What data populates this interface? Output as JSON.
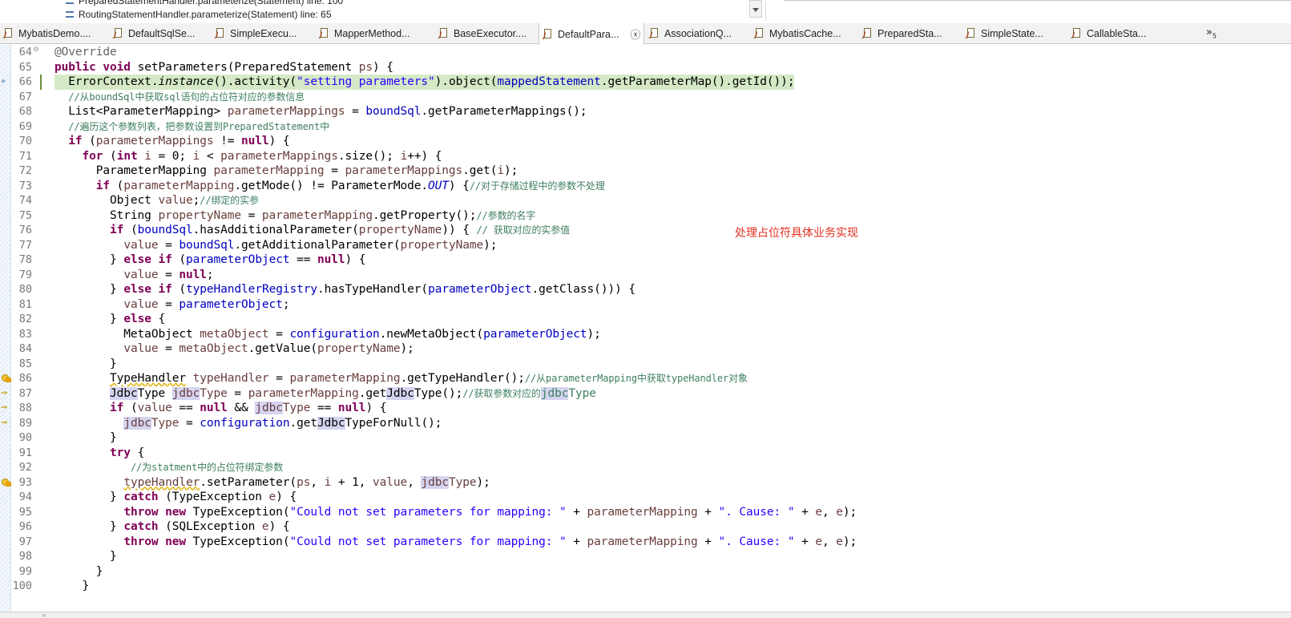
{
  "stack_panel": {
    "lines": [
      "PreparedStatementHandler.parameterize(Statement) line: 100",
      "RoutingStatementHandler.parameterize(Statement) line: 65"
    ]
  },
  "tabs": [
    {
      "label": "MybatisDemo....",
      "active": false
    },
    {
      "label": "DefaultSqlSe...",
      "active": false
    },
    {
      "label": "SimpleExecu...",
      "active": false
    },
    {
      "label": "MapperMethod...",
      "active": false
    },
    {
      "label": "BaseExecutor....",
      "active": false
    },
    {
      "label": "DefaultPara...",
      "active": true
    },
    {
      "label": "AssociationQ...",
      "active": false
    },
    {
      "label": "MybatisCache...",
      "active": false
    },
    {
      "label": "PreparedSta...",
      "active": false
    },
    {
      "label": "SimpleState...",
      "active": false
    },
    {
      "label": "CallableSta...",
      "active": false
    }
  ],
  "overflow": {
    "symbol": "»",
    "count": "5"
  },
  "close_symbol": "ⓧ",
  "editor": {
    "current_line": 66,
    "fold_symbol": "⊖",
    "lines": [
      {
        "n": "64",
        "tokens": [
          [
            "ann",
            "@Override"
          ]
        ]
      },
      {
        "n": "65",
        "tokens": [
          [
            "kw",
            "public"
          ],
          [
            "",
            " "
          ],
          [
            "kw",
            "void"
          ],
          [
            "",
            " setParameters(PreparedStatement "
          ],
          [
            "loc",
            "ps"
          ],
          [
            "",
            ") {"
          ]
        ]
      },
      {
        "n": "66",
        "tokens": [
          [
            "",
            "  ErrorContext."
          ],
          [
            "ital",
            "instance"
          ],
          [
            "",
            "().activity("
          ],
          [
            "str",
            "\"setting parameters\""
          ],
          [
            "",
            ")."
          ],
          [
            "",
            "object("
          ],
          [
            "fld",
            "mappedStatement"
          ],
          [
            "",
            ".getParameterMap().getId());"
          ]
        ]
      },
      {
        "n": "67",
        "tokens": [
          [
            "",
            "  "
          ],
          [
            "cm",
            "//从boundSql中获取sql语句的占位符对应的参数信息"
          ]
        ]
      },
      {
        "n": "68",
        "tokens": [
          [
            "",
            "  List<ParameterMapping> "
          ],
          [
            "loc",
            "parameterMappings"
          ],
          [
            "",
            " = "
          ],
          [
            "fld",
            "boundSql"
          ],
          [
            "",
            ".getParameterMappings();"
          ]
        ]
      },
      {
        "n": "69",
        "tokens": [
          [
            "",
            "  "
          ],
          [
            "cm",
            "//遍历这个参数列表，把参数设置到PreparedStatement中"
          ]
        ]
      },
      {
        "n": "70",
        "tokens": [
          [
            "",
            "  "
          ],
          [
            "kw",
            "if"
          ],
          [
            "",
            " ("
          ],
          [
            "loc",
            "parameterMappings"
          ],
          [
            "",
            " != "
          ],
          [
            "kw",
            "null"
          ],
          [
            "",
            ") {"
          ]
        ]
      },
      {
        "n": "71",
        "tokens": [
          [
            "",
            "    "
          ],
          [
            "kw",
            "for"
          ],
          [
            "",
            " ("
          ],
          [
            "kw",
            "int"
          ],
          [
            "",
            " "
          ],
          [
            "loc",
            "i"
          ],
          [
            "",
            " = 0; "
          ],
          [
            "loc",
            "i"
          ],
          [
            "",
            " < "
          ],
          [
            "loc",
            "parameterMappings"
          ],
          [
            "",
            ".size(); "
          ],
          [
            "loc",
            "i"
          ],
          [
            "",
            "++) {"
          ]
        ]
      },
      {
        "n": "72",
        "tokens": [
          [
            "",
            "      ParameterMapping "
          ],
          [
            "loc",
            "parameterMapping"
          ],
          [
            "",
            " = "
          ],
          [
            "loc",
            "parameterMappings"
          ],
          [
            "",
            ".get("
          ],
          [
            "loc",
            "i"
          ],
          [
            "",
            ");"
          ]
        ]
      },
      {
        "n": "73",
        "tokens": [
          [
            "",
            "      "
          ],
          [
            "kw",
            "if"
          ],
          [
            "",
            " ("
          ],
          [
            "loc",
            "parameterMapping"
          ],
          [
            "",
            ".getMode() != ParameterMode."
          ],
          [
            "fld-it",
            "OUT"
          ],
          [
            "",
            ") {"
          ],
          [
            "cm",
            "//对于存储过程中的参数不处理"
          ]
        ]
      },
      {
        "n": "74",
        "tokens": [
          [
            "",
            "        Object "
          ],
          [
            "loc",
            "value"
          ],
          [
            "",
            ";"
          ],
          [
            "cm",
            "//绑定的实参"
          ]
        ]
      },
      {
        "n": "75",
        "tokens": [
          [
            "",
            "        String "
          ],
          [
            "loc",
            "propertyName"
          ],
          [
            "",
            " = "
          ],
          [
            "loc",
            "parameterMapping"
          ],
          [
            "",
            ".getProperty();"
          ],
          [
            "cm",
            "//参数的名字"
          ]
        ]
      },
      {
        "n": "76",
        "tokens": [
          [
            "",
            "        "
          ],
          [
            "kw",
            "if"
          ],
          [
            "",
            " ("
          ],
          [
            "fld",
            "boundSql"
          ],
          [
            "",
            ".hasAdditionalParameter("
          ],
          [
            "loc",
            "propertyName"
          ],
          [
            "",
            ")) { "
          ],
          [
            "cm",
            "// 获取对应的实参值"
          ]
        ]
      },
      {
        "n": "77",
        "tokens": [
          [
            "",
            "          "
          ],
          [
            "loc",
            "value"
          ],
          [
            "",
            " = "
          ],
          [
            "fld",
            "boundSql"
          ],
          [
            "",
            ".getAdditionalParameter("
          ],
          [
            "loc",
            "propertyName"
          ],
          [
            "",
            ");"
          ]
        ]
      },
      {
        "n": "78",
        "tokens": [
          [
            "",
            "        } "
          ],
          [
            "kw",
            "else"
          ],
          [
            "",
            " "
          ],
          [
            "kw",
            "if"
          ],
          [
            "",
            " ("
          ],
          [
            "fld",
            "parameterObject"
          ],
          [
            "",
            " == "
          ],
          [
            "kw",
            "null"
          ],
          [
            "",
            ") {"
          ]
        ]
      },
      {
        "n": "79",
        "tokens": [
          [
            "",
            "          "
          ],
          [
            "loc",
            "value"
          ],
          [
            "",
            " = "
          ],
          [
            "kw",
            "null"
          ],
          [
            "",
            ";"
          ]
        ]
      },
      {
        "n": "80",
        "tokens": [
          [
            "",
            "        } "
          ],
          [
            "kw",
            "else"
          ],
          [
            "",
            " "
          ],
          [
            "kw",
            "if"
          ],
          [
            "",
            " ("
          ],
          [
            "fld",
            "typeHandlerRegistry"
          ],
          [
            "",
            ".hasTypeHandler("
          ],
          [
            "fld",
            "parameterObject"
          ],
          [
            "",
            ".getClass())) {"
          ]
        ]
      },
      {
        "n": "81",
        "tokens": [
          [
            "",
            "          "
          ],
          [
            "loc",
            "value"
          ],
          [
            "",
            " = "
          ],
          [
            "fld",
            "parameterObject"
          ],
          [
            "",
            ";"
          ]
        ]
      },
      {
        "n": "82",
        "tokens": [
          [
            "",
            "        } "
          ],
          [
            "kw",
            "else"
          ],
          [
            "",
            " {"
          ]
        ]
      },
      {
        "n": "83",
        "tokens": [
          [
            "",
            "          MetaObject "
          ],
          [
            "loc",
            "metaObject"
          ],
          [
            "",
            " = "
          ],
          [
            "fld",
            "configuration"
          ],
          [
            "",
            ".newMetaObject("
          ],
          [
            "fld",
            "parameterObject"
          ],
          [
            "",
            ");"
          ]
        ]
      },
      {
        "n": "84",
        "tokens": [
          [
            "",
            "          "
          ],
          [
            "loc",
            "value"
          ],
          [
            "",
            " = "
          ],
          [
            "loc",
            "metaObject"
          ],
          [
            "",
            ".getValue("
          ],
          [
            "loc",
            "propertyName"
          ],
          [
            "",
            ");"
          ]
        ]
      },
      {
        "n": "85",
        "tokens": [
          [
            "",
            "        }"
          ]
        ]
      },
      {
        "n": "86",
        "tokens": [
          [
            "",
            "        "
          ],
          [
            "sq",
            "TypeHandler"
          ],
          [
            "",
            " "
          ],
          [
            "loc",
            "typeHandler"
          ],
          [
            "",
            " = "
          ],
          [
            "loc",
            "parameterMapping"
          ],
          [
            "",
            ".getTypeHandler();"
          ],
          [
            "cm",
            "//从parameterMapping中获取typeHandler对象"
          ]
        ]
      },
      {
        "n": "87",
        "tokens": [
          [
            "",
            "        "
          ],
          [
            "hl",
            "Jdbc"
          ],
          [
            "",
            "Type "
          ],
          [
            "hl-loc",
            "jdbc"
          ],
          [
            "loc",
            "Type"
          ],
          [
            "",
            " = "
          ],
          [
            "loc",
            "parameterMapping"
          ],
          [
            "",
            ".get"
          ],
          [
            "hl",
            "Jdbc"
          ],
          [
            "",
            "Type();"
          ],
          [
            "cm",
            "//获取参数对应的"
          ],
          [
            "hl-cm",
            "jdbc"
          ],
          [
            "cm",
            "Type"
          ]
        ]
      },
      {
        "n": "88",
        "tokens": [
          [
            "",
            "        "
          ],
          [
            "kw",
            "if"
          ],
          [
            "",
            " ("
          ],
          [
            "loc",
            "value"
          ],
          [
            "",
            " == "
          ],
          [
            "kw",
            "null"
          ],
          [
            "",
            " && "
          ],
          [
            "hl-loc",
            "jdbc"
          ],
          [
            "loc",
            "Type"
          ],
          [
            "",
            " == "
          ],
          [
            "kw",
            "null"
          ],
          [
            "",
            ") {"
          ]
        ]
      },
      {
        "n": "89",
        "tokens": [
          [
            "",
            "          "
          ],
          [
            "hl-loc",
            "jdbc"
          ],
          [
            "loc",
            "Type"
          ],
          [
            "",
            " = "
          ],
          [
            "fld",
            "configuration"
          ],
          [
            "",
            ".get"
          ],
          [
            "hl",
            "Jdbc"
          ],
          [
            "",
            "TypeForNull();"
          ]
        ]
      },
      {
        "n": "90",
        "tokens": [
          [
            "",
            "        }"
          ]
        ]
      },
      {
        "n": "91",
        "tokens": [
          [
            "",
            "        "
          ],
          [
            "kw",
            "try"
          ],
          [
            "",
            " {"
          ]
        ]
      },
      {
        "n": "92",
        "tokens": [
          [
            "",
            "           "
          ],
          [
            "cm",
            "//为statment中的占位符绑定参数"
          ]
        ]
      },
      {
        "n": "93",
        "tokens": [
          [
            "",
            "          "
          ],
          [
            "sq-loc",
            "typeHandler"
          ],
          [
            "",
            ".setParameter("
          ],
          [
            "loc",
            "ps"
          ],
          [
            "",
            ", "
          ],
          [
            "loc",
            "i"
          ],
          [
            "",
            " + 1, "
          ],
          [
            "loc",
            "value"
          ],
          [
            "",
            ", "
          ],
          [
            "hl-loc",
            "jdbc"
          ],
          [
            "loc",
            "Type"
          ],
          [
            "",
            ");"
          ]
        ]
      },
      {
        "n": "94",
        "tokens": [
          [
            "",
            "        } "
          ],
          [
            "kw",
            "catch"
          ],
          [
            "",
            " (TypeException "
          ],
          [
            "loc",
            "e"
          ],
          [
            "",
            ") {"
          ]
        ]
      },
      {
        "n": "95",
        "tokens": [
          [
            "",
            "          "
          ],
          [
            "kw",
            "throw"
          ],
          [
            "",
            " "
          ],
          [
            "kw",
            "new"
          ],
          [
            "",
            " TypeException("
          ],
          [
            "str",
            "\"Could not set parameters for mapping: \""
          ],
          [
            "",
            " + "
          ],
          [
            "loc",
            "parameterMapping"
          ],
          [
            "",
            " + "
          ],
          [
            "str",
            "\". Cause: \""
          ],
          [
            "",
            " + "
          ],
          [
            "loc",
            "e"
          ],
          [
            "",
            ", "
          ],
          [
            "loc",
            "e"
          ],
          [
            "",
            ");"
          ]
        ]
      },
      {
        "n": "96",
        "tokens": [
          [
            "",
            "        } "
          ],
          [
            "kw",
            "catch"
          ],
          [
            "",
            " (SQLException "
          ],
          [
            "loc",
            "e"
          ],
          [
            "",
            ") {"
          ]
        ]
      },
      {
        "n": "97",
        "tokens": [
          [
            "",
            "          "
          ],
          [
            "kw",
            "throw"
          ],
          [
            "",
            " "
          ],
          [
            "kw",
            "new"
          ],
          [
            "",
            " TypeException("
          ],
          [
            "str",
            "\"Could not set parameters for mapping: \""
          ],
          [
            "",
            " + "
          ],
          [
            "loc",
            "parameterMapping"
          ],
          [
            "",
            " + "
          ],
          [
            "str",
            "\". Cause: \""
          ],
          [
            "",
            " + "
          ],
          [
            "loc",
            "e"
          ],
          [
            "",
            ", "
          ],
          [
            "loc",
            "e"
          ],
          [
            "",
            ");"
          ]
        ]
      },
      {
        "n": "98",
        "tokens": [
          [
            "",
            "        }"
          ]
        ]
      },
      {
        "n": "99",
        "tokens": [
          [
            "",
            "      }"
          ]
        ]
      },
      {
        "n": "100",
        "tokens": [
          [
            "",
            "    }"
          ]
        ]
      }
    ]
  },
  "annotation": "处理占位符具体业务实现",
  "colors": {
    "keyword": "#7f0055",
    "string": "#2a00ff",
    "comment": "#3f7f5f",
    "field": "#0000c0",
    "local": "#6a3e3e",
    "current_line_bg": "#d6e9c6",
    "occurrence_bg": "#d4d4f0",
    "annotation": "#e03020"
  }
}
